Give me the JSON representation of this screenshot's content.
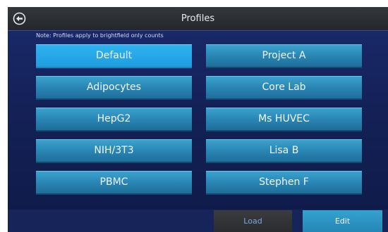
{
  "header": {
    "title": "Profiles",
    "back_icon": "circle-arrow-left-icon"
  },
  "note": "Note: Profiles apply to brightfield only counts",
  "profiles": [
    {
      "label": "Default",
      "selected": true
    },
    {
      "label": "Project A",
      "selected": false
    },
    {
      "label": "Adipocytes",
      "selected": false
    },
    {
      "label": "Core Lab",
      "selected": false
    },
    {
      "label": "HepG2",
      "selected": false
    },
    {
      "label": "Ms HUVEC",
      "selected": false
    },
    {
      "label": "NIH/3T3",
      "selected": false
    },
    {
      "label": "Lisa B",
      "selected": false
    },
    {
      "label": "PBMC",
      "selected": false
    },
    {
      "label": "Stephen F",
      "selected": false
    }
  ],
  "footer": {
    "load_label": "Load",
    "edit_label": "Edit"
  },
  "colors": {
    "accent": "#2fb1ee",
    "button": "#2a87b5",
    "background": "#142157"
  }
}
